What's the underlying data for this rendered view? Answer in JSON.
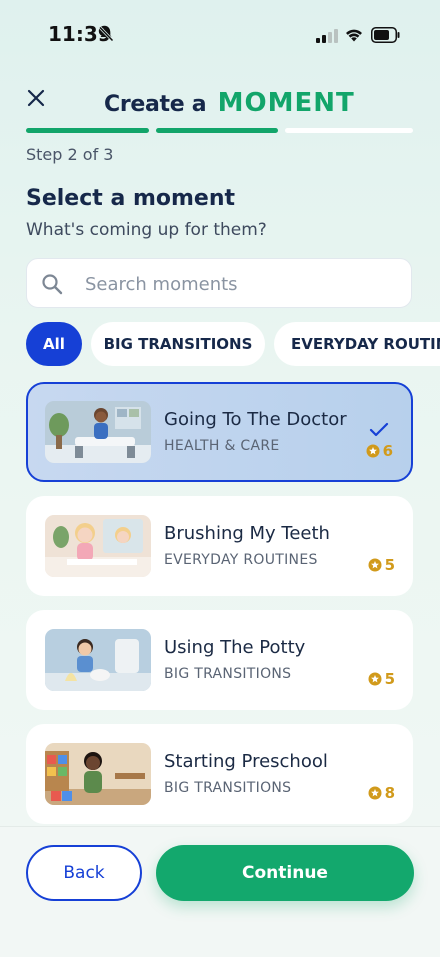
{
  "status_bar": {
    "time": "11:39"
  },
  "header": {
    "title_prefix": "Create a",
    "title_accent": "MOMENT"
  },
  "step": {
    "label": "Step 2 of 3",
    "current": 2,
    "total": 3
  },
  "section": {
    "heading": "Select a moment",
    "subheading": "What's coming up for them?"
  },
  "search": {
    "placeholder": "Search moments",
    "value": ""
  },
  "filters": [
    {
      "label": "All",
      "active": true
    },
    {
      "label": "BIG TRANSITIONS",
      "active": false
    },
    {
      "label": "EVERYDAY ROUTIN",
      "active": false
    }
  ],
  "moments": [
    {
      "title": "Going To The Doctor",
      "category": "HEALTH & CARE",
      "points": "6",
      "selected": true
    },
    {
      "title": "Brushing My Teeth",
      "category": "EVERYDAY ROUTINES",
      "points": "5",
      "selected": false
    },
    {
      "title": "Using The Potty",
      "category": "BIG TRANSITIONS",
      "points": "5",
      "selected": false
    },
    {
      "title": "Starting Preschool",
      "category": "BIG TRANSITIONS",
      "points": "8",
      "selected": false
    }
  ],
  "actions": {
    "back_label": "Back",
    "continue_label": "Continue"
  },
  "colors": {
    "accent_green": "#12a56a",
    "primary_blue": "#1640d6",
    "points_gold": "#d19a1b"
  },
  "icons": [
    "bell-off-icon",
    "signal-icon",
    "wifi-icon",
    "battery-icon",
    "close-icon",
    "search-icon",
    "check-icon",
    "star-coin-icon"
  ]
}
